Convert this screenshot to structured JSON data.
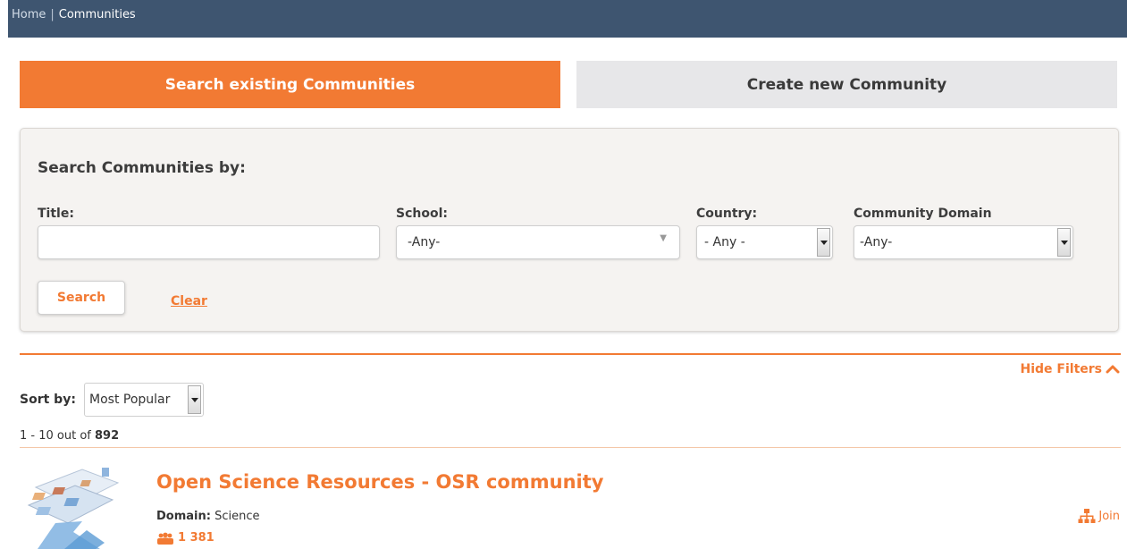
{
  "breadcrumb": {
    "home": "Home",
    "separator": "|",
    "current": "Communities"
  },
  "tabs": {
    "search": "Search existing Communities",
    "create": "Create new Community"
  },
  "filters": {
    "heading": "Search Communities by:",
    "title_label": "Title:",
    "title_value": "",
    "school_label": "School:",
    "school_value": "-Any-",
    "country_label": "Country:",
    "country_value": "- Any -",
    "domain_label": "Community Domain",
    "domain_value": "-Any-",
    "search_button": "Search",
    "clear_link": "Clear"
  },
  "hide_filters": "Hide Filters",
  "sort": {
    "label": "Sort by:",
    "value": "Most Popular"
  },
  "results": {
    "range": "1 - 10 out of",
    "total": "892"
  },
  "communities": [
    {
      "title": "Open Science Resources - OSR community",
      "domain_label": "Domain:",
      "domain": "Science",
      "members": "1 381",
      "join": "Join"
    }
  ],
  "colors": {
    "accent": "#f27a33",
    "topbar": "#3e5570",
    "panel": "#f5f3f1"
  }
}
